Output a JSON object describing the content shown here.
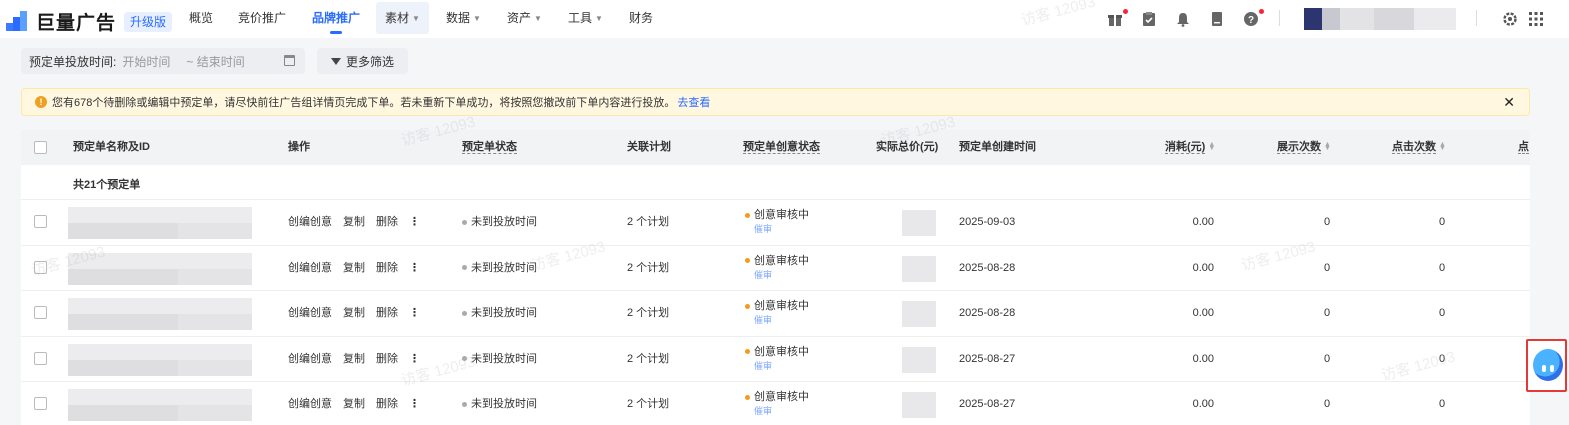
{
  "brand": {
    "name": "巨量广告",
    "badge": "升级版"
  },
  "nav": [
    {
      "label": "概览",
      "dropdown": false
    },
    {
      "label": "竞价推广",
      "dropdown": false
    },
    {
      "label": "品牌推广",
      "dropdown": false,
      "active": true
    },
    {
      "label": "素材",
      "dropdown": true
    },
    {
      "label": "数据",
      "dropdown": true
    },
    {
      "label": "资产",
      "dropdown": true
    },
    {
      "label": "工具",
      "dropdown": true
    },
    {
      "label": "财务",
      "dropdown": false
    }
  ],
  "header_icons": [
    "gift-icon",
    "clipboard-icon",
    "bell-icon",
    "book-icon",
    "help-icon",
    "settings-icon",
    "apps-icon"
  ],
  "filters": {
    "date_label": "预定单投放时间:",
    "start_placeholder": "开始时间",
    "end_placeholder": "~ 结束时间",
    "more_label": "更多筛选"
  },
  "notice": {
    "text": "您有678个待删除或编辑中预定单，请尽快前往广告组详情页完成下单。若未重新下单成功，将按照您撤改前下单内容进行投放。",
    "link": "去查看"
  },
  "table": {
    "columns": [
      "预定单名称及ID",
      "操作",
      "预定单状态",
      "关联计划",
      "预定单创意状态",
      "实际总价(元)",
      "预定单创建时间",
      "消耗(元)",
      "展示次数",
      "点击次数",
      "点"
    ],
    "summary": "共21个预定单",
    "actions": [
      "创编创意",
      "复制",
      "删除",
      "⋮"
    ],
    "rows": [
      {
        "status": "未到投放时间",
        "plans": "2 个计划",
        "creative_status": "创意审核中",
        "creative_sub": "催审",
        "created": "2025-09-03",
        "cost": "0.00",
        "impressions": "0",
        "clicks": "0"
      },
      {
        "status": "未到投放时间",
        "plans": "2 个计划",
        "creative_status": "创意审核中",
        "creative_sub": "催审",
        "created": "2025-08-28",
        "cost": "0.00",
        "impressions": "0",
        "clicks": "0"
      },
      {
        "status": "未到投放时间",
        "plans": "2 个计划",
        "creative_status": "创意审核中",
        "creative_sub": "催审",
        "created": "2025-08-28",
        "cost": "0.00",
        "impressions": "0",
        "clicks": "0"
      },
      {
        "status": "未到投放时间",
        "plans": "2 个计划",
        "creative_status": "创意审核中",
        "creative_sub": "催审",
        "created": "2025-08-27",
        "cost": "0.00",
        "impressions": "0",
        "clicks": "0"
      },
      {
        "status": "未到投放时间",
        "plans": "2 个计划",
        "creative_status": "创意审核中",
        "creative_sub": "催审",
        "created": "2025-08-27",
        "cost": "0.00",
        "impressions": "0",
        "clicks": "0"
      }
    ]
  },
  "watermark": "访客 12093",
  "colors": {
    "accent": "#2b6bff",
    "warning_bg": "#fff7e0",
    "creative_dot": "#f39b1c"
  }
}
